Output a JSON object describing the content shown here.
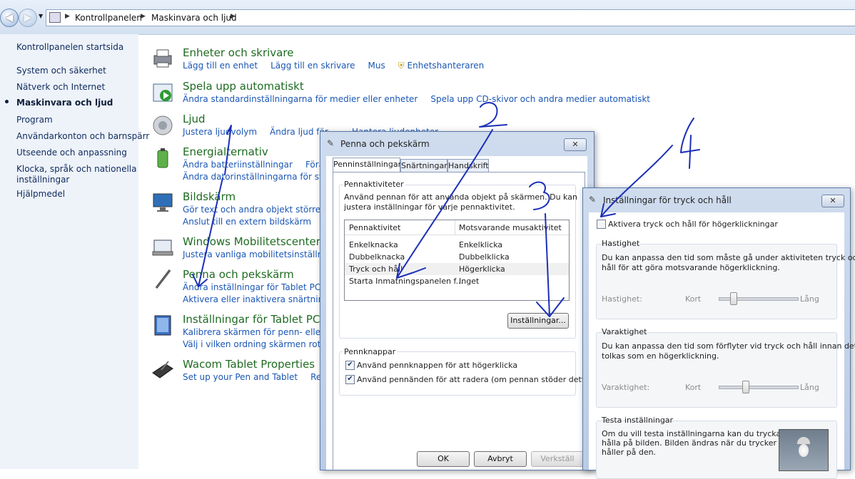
{
  "addressbar": {
    "crumbs": [
      "Kontrollpanelen",
      "Maskinvara och ljud"
    ]
  },
  "leftnav": {
    "items": [
      {
        "label": "Kontrollpanelen startsida",
        "active": false
      },
      {
        "label": "System och säkerhet",
        "active": false
      },
      {
        "label": "Nätverk och Internet",
        "active": false
      },
      {
        "label": "Maskinvara och ljud",
        "active": true
      },
      {
        "label": "Program",
        "active": false
      },
      {
        "label": "Användarkonton och barnspärr",
        "active": false
      },
      {
        "label": "Utseende och anpassning",
        "active": false
      },
      {
        "label": "Klocka, språk och nationella",
        "active": false
      },
      {
        "label": "inställningar",
        "active": false
      },
      {
        "label": "Hjälpmedel",
        "active": false
      }
    ]
  },
  "categories": [
    {
      "title": "Enheter och skrivare",
      "icon": "printer-icon",
      "links": [
        "Lägg till en enhet",
        "Lägg till en skrivare",
        "Mus",
        "Enhetshanteraren"
      ]
    },
    {
      "title": "Spela upp automatiskt",
      "icon": "autoplay-icon",
      "links": [
        "Ändra standardinställningarna för medier eller enheter",
        "Spela upp CD-skivor och andra medier automatiskt"
      ]
    },
    {
      "title": "Ljud",
      "icon": "speaker-icon",
      "links": [
        "Justera ljudvolym",
        "Ändra ljud för ...",
        "Hantera ljudenheter"
      ]
    },
    {
      "title": "Energialternativ",
      "icon": "battery-icon",
      "links": [
        "Ändra batteriinställningar",
        "Föränd..."
      ],
      "links2": [
        "Ändra datorinställningarna för ström..."
      ]
    },
    {
      "title": "Bildskärm",
      "icon": "monitor-icon",
      "links": [
        "Gör text och andra objekt större eller..."
      ],
      "links2": [
        "Anslut till en extern bildskärm"
      ]
    },
    {
      "title": "Windows Mobilitetscenter",
      "icon": "mobility-icon",
      "links": [
        "Justera vanliga mobilitetsinställninga..."
      ]
    },
    {
      "title": "Penna och pekskärm",
      "icon": "pen-icon",
      "links": [
        "Ändra inställningar för Tablet PC-pe..."
      ],
      "links2": [
        "Aktivera eller inaktivera snärtningar"
      ]
    },
    {
      "title": "Inställningar för Tablet PC",
      "icon": "tablet-icon",
      "links": [
        "Kalibrera skärmen för penn- eller tryc..."
      ],
      "links2": [
        "Välj i vilken ordning skärmen roteras"
      ]
    },
    {
      "title": "Wacom Tablet Properties",
      "icon": "wacom-icon",
      "links": [
        "Set up your Pen and Tablet",
        "Remo..."
      ]
    }
  ],
  "dialog1": {
    "title": "Penna och pekskärm",
    "close": "✕",
    "tabs": [
      "Penninställningar",
      "Snärtningar",
      "Handskrift"
    ],
    "group1_label": "Pennaktiviteter",
    "group1_text": [
      "Använd pennan för att använda objekt på skärmen. Du kan",
      "justera inställningar för varje pennaktivitet."
    ],
    "table_headers": [
      "Pennaktivitet",
      "Motsvarande musaktivitet"
    ],
    "table_rows": [
      [
        "Enkelknacka",
        "Enkelklicka"
      ],
      [
        "Dubbelknacka",
        "Dubbelklicka"
      ],
      [
        "Tryck och håll",
        "Högerklicka"
      ],
      [
        "Starta Inmatningspanelen f...",
        "Inget"
      ]
    ],
    "settings_button": "Inställningar...",
    "group2_label": "Pennknappar",
    "check1": "Använd pennknappen för att högerklicka",
    "check2": "Använd pennänden för att radera (om pennan stöder detta)",
    "ok": "OK",
    "cancel": "Avbryt",
    "apply": "Verkställ"
  },
  "dialog2": {
    "title": "Inställningar för tryck och håll",
    "close": "✕",
    "enable_check": "Aktivera tryck och håll för högerklickningar",
    "speed_label": "Hastighet",
    "speed_text": [
      "Du kan anpassa den tid som måste gå under aktiviteten tryck och",
      "håll för att göra motsvarande högerklickning."
    ],
    "speed_slider_label": "Hastighet:",
    "speed_min": "Kort",
    "speed_max": "Lång",
    "duration_label": "Varaktighet",
    "duration_text": [
      "Du kan anpassa den tid som förflyter vid tryck och håll innan det",
      "tolkas som en högerklickning."
    ],
    "duration_slider_label": "Varaktighet:",
    "duration_min": "Kort",
    "duration_max": "Lång",
    "test_label": "Testa inställningar",
    "test_text": [
      "Om du vill testa inställningarna kan du trycka och",
      "hålla på bilden. Bilden ändras när du trycker och",
      "håller på den."
    ]
  },
  "annotations": [
    "1",
    "2",
    "3",
    "4"
  ],
  "colors": {
    "link": "#1a56b5",
    "title": "#1e6b21",
    "annot": "#1b2fb8"
  }
}
